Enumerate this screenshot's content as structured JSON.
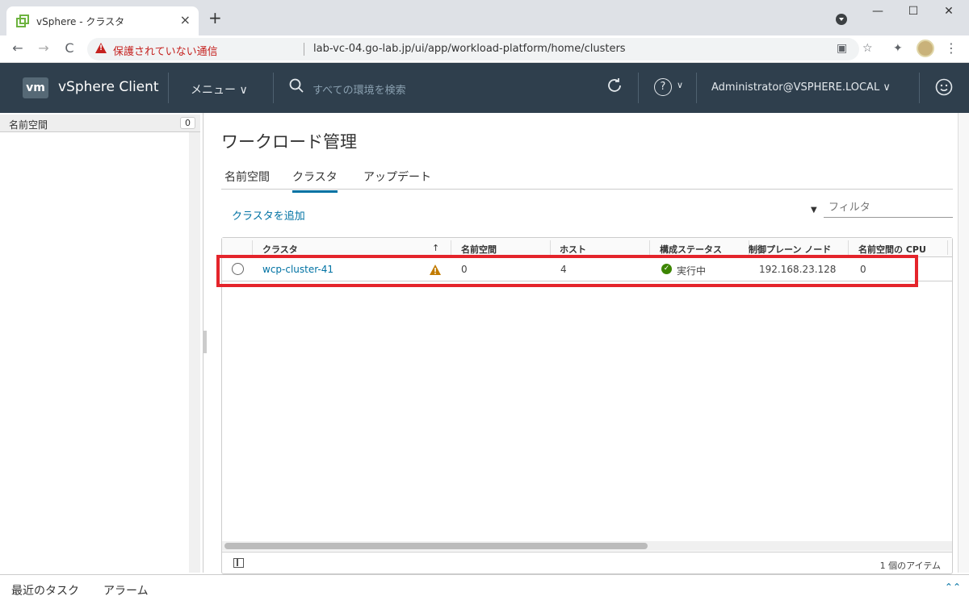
{
  "browser": {
    "tab_title": "vSphere - クラスタ",
    "new_tab": "+",
    "back": "←",
    "forward": "→",
    "reload": "C",
    "insecure_label": "保護されていない通信",
    "url": "lab-vc-04.go-lab.jp/ui/app/workload-platform/home/clusters",
    "window": {
      "minimize": "—",
      "maximize": "☐",
      "close": "✕"
    }
  },
  "header": {
    "logo": "vm",
    "app_name": "vSphere Client",
    "menu_label": "メニュー ∨",
    "search_placeholder": "すべての環境を検索",
    "user": "Administrator@VSPHERE.LOCAL ∨",
    "help_symbol": "?",
    "help_chevron": "∨"
  },
  "left_pane": {
    "title": "名前空間",
    "count": "0"
  },
  "main": {
    "title": "ワークロード管理",
    "tabs": [
      "名前空間",
      "クラスタ",
      "アップデート"
    ],
    "active_tab": "クラスタ",
    "add_cluster": "クラスタを追加",
    "filter_placeholder": "フィルタ",
    "filter_icon": "▼"
  },
  "grid": {
    "columns": [
      "クラスタ",
      "↑",
      "名前空間",
      "ホスト",
      "構成ステータス",
      "制御プレーン ノード",
      "名前空間の CPU"
    ],
    "rows": [
      {
        "cluster": "wcp-cluster-41",
        "warning": true,
        "namespaces": "0",
        "hosts": "4",
        "status": "実行中",
        "control_plane": "192.168.23.128",
        "cpu": "0"
      }
    ],
    "footer": "1 個のアイテム"
  },
  "bottom": {
    "tabs": [
      "最近のタスク",
      "アラーム"
    ],
    "expand": "⌃⌃"
  },
  "colors": {
    "header_bg": "#2f3f4d",
    "link": "#0072a3",
    "highlight": "#e4242b",
    "ok": "#3c8500",
    "warning": "#c27b00"
  }
}
